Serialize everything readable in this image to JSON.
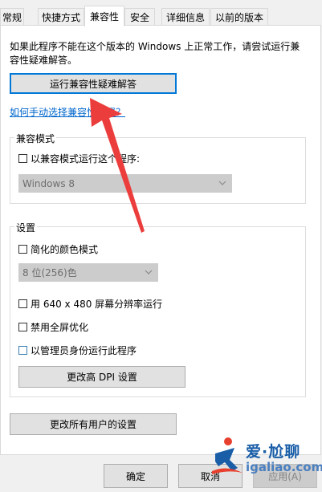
{
  "tabs": [
    {
      "label": "常规"
    },
    {
      "label": "快捷方式"
    },
    {
      "label": "兼容性",
      "active": true
    },
    {
      "label": "安全"
    },
    {
      "label": "详细信息"
    },
    {
      "label": "以前的版本"
    }
  ],
  "intro_text": "如果此程序不能在这个版本的 Windows 上正常工作，请尝试运行兼容性疑难解答。",
  "troubleshoot_button": "运行兼容性疑难解答",
  "manual_link": "如何手动选择兼容性设置？",
  "compat_mode": {
    "group_label": "兼容模式",
    "checkbox_label": "以兼容模式运行这个程序:",
    "checked": false,
    "select_value": "Windows 8"
  },
  "settings": {
    "group_label": "设置",
    "reduced_color": {
      "label": "简化的颜色模式",
      "checked": false
    },
    "color_select_value": "8 位(256)色",
    "res_640": {
      "label": "用 640 x 480 屏幕分辨率运行",
      "checked": false
    },
    "disable_fullscreen": {
      "label": "禁用全屏优化",
      "checked": false
    },
    "run_as_admin": {
      "label": "以管理员身份运行此程序",
      "checked": false
    },
    "dpi_button": "更改高 DPI 设置"
  },
  "all_users_button": "更改所有用户的设置",
  "footer": {
    "ok": "确定",
    "cancel": "取消",
    "apply": "应用(A)"
  },
  "watermark": {
    "title": "爱·尬聊",
    "url": "igaliao.com"
  },
  "colors": {
    "accent": "#0078d7",
    "link": "#0066cc",
    "arrow": "#ec3d3d"
  }
}
